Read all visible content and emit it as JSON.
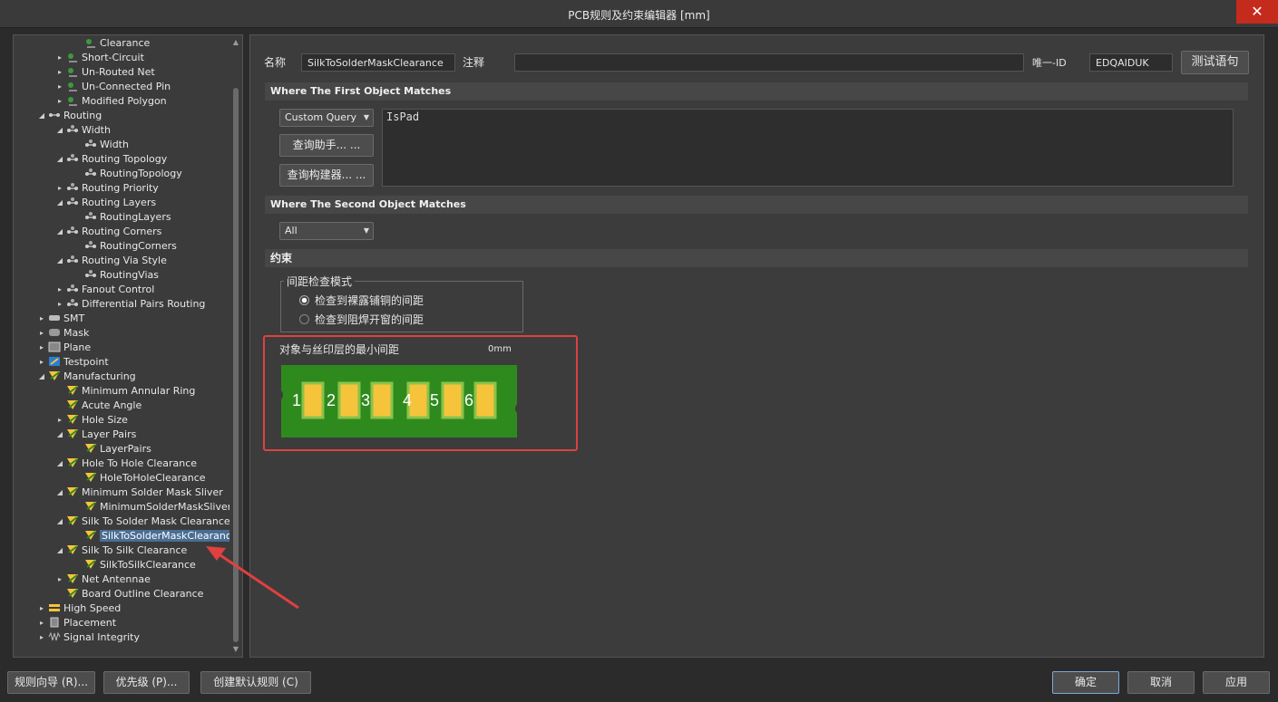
{
  "window": {
    "title": "PCB规则及约束编辑器 [mm]",
    "close_glyph": "✕"
  },
  "tree": {
    "items": [
      {
        "label": "Clearance",
        "level": 3,
        "toggle": "",
        "icon": "clearance-rule-icon"
      },
      {
        "label": "Short-Circuit",
        "level": 2,
        "toggle": "▸",
        "icon": "short-circuit-icon"
      },
      {
        "label": "Un-Routed Net",
        "level": 2,
        "toggle": "▸",
        "icon": "unrouted-net-icon"
      },
      {
        "label": "Un-Connected Pin",
        "level": 2,
        "toggle": "▸",
        "icon": "unconnected-pin-icon"
      },
      {
        "label": "Modified Polygon",
        "level": 2,
        "toggle": "▸",
        "icon": "modified-polygon-icon"
      },
      {
        "label": "Routing",
        "level": 1,
        "toggle": "◢",
        "icon": "routing-category-icon"
      },
      {
        "label": "Width",
        "level": 2,
        "toggle": "◢",
        "icon": "routing-rule-icon"
      },
      {
        "label": "Width",
        "level": 3,
        "toggle": "",
        "icon": "routing-rule-icon"
      },
      {
        "label": "Routing Topology",
        "level": 2,
        "toggle": "◢",
        "icon": "routing-rule-icon"
      },
      {
        "label": "RoutingTopology",
        "level": 3,
        "toggle": "",
        "icon": "routing-rule-icon"
      },
      {
        "label": "Routing Priority",
        "level": 2,
        "toggle": "▸",
        "icon": "routing-rule-icon"
      },
      {
        "label": "Routing Layers",
        "level": 2,
        "toggle": "◢",
        "icon": "routing-rule-icon"
      },
      {
        "label": "RoutingLayers",
        "level": 3,
        "toggle": "",
        "icon": "routing-rule-icon"
      },
      {
        "label": "Routing Corners",
        "level": 2,
        "toggle": "◢",
        "icon": "routing-rule-icon"
      },
      {
        "label": "RoutingCorners",
        "level": 3,
        "toggle": "",
        "icon": "routing-rule-icon"
      },
      {
        "label": "Routing Via Style",
        "level": 2,
        "toggle": "◢",
        "icon": "routing-rule-icon"
      },
      {
        "label": "RoutingVias",
        "level": 3,
        "toggle": "",
        "icon": "routing-rule-icon"
      },
      {
        "label": "Fanout Control",
        "level": 2,
        "toggle": "▸",
        "icon": "routing-rule-icon"
      },
      {
        "label": "Differential Pairs Routing",
        "level": 2,
        "toggle": "▸",
        "icon": "routing-rule-icon"
      },
      {
        "label": "SMT",
        "level": 1,
        "toggle": "▸",
        "icon": "smt-icon"
      },
      {
        "label": "Mask",
        "level": 1,
        "toggle": "▸",
        "icon": "mask-icon"
      },
      {
        "label": "Plane",
        "level": 1,
        "toggle": "▸",
        "icon": "plane-icon"
      },
      {
        "label": "Testpoint",
        "level": 1,
        "toggle": "▸",
        "icon": "testpoint-icon"
      },
      {
        "label": "Manufacturing",
        "level": 1,
        "toggle": "◢",
        "icon": "manufacturing-icon"
      },
      {
        "label": "Minimum Annular Ring",
        "level": 2,
        "toggle": "",
        "icon": "manufacturing-rule-icon"
      },
      {
        "label": "Acute Angle",
        "level": 2,
        "toggle": "",
        "icon": "manufacturing-rule-icon"
      },
      {
        "label": "Hole Size",
        "level": 2,
        "toggle": "▸",
        "icon": "manufacturing-rule-icon"
      },
      {
        "label": "Layer Pairs",
        "level": 2,
        "toggle": "◢",
        "icon": "manufacturing-rule-icon"
      },
      {
        "label": "LayerPairs",
        "level": 3,
        "toggle": "",
        "icon": "manufacturing-rule-icon"
      },
      {
        "label": "Hole To Hole Clearance",
        "level": 2,
        "toggle": "◢",
        "icon": "manufacturing-rule-icon"
      },
      {
        "label": "HoleToHoleClearance",
        "level": 3,
        "toggle": "",
        "icon": "manufacturing-rule-icon"
      },
      {
        "label": "Minimum Solder Mask Sliver",
        "level": 2,
        "toggle": "◢",
        "icon": "manufacturing-rule-icon"
      },
      {
        "label": "MinimumSolderMaskSliver",
        "level": 3,
        "toggle": "",
        "icon": "manufacturing-rule-icon"
      },
      {
        "label": "Silk To Solder Mask Clearance",
        "level": 2,
        "toggle": "◢",
        "icon": "manufacturing-rule-icon"
      },
      {
        "label": "SilkToSolderMaskClearance",
        "level": 3,
        "toggle": "",
        "icon": "manufacturing-rule-icon",
        "selected": true
      },
      {
        "label": "Silk To Silk Clearance",
        "level": 2,
        "toggle": "◢",
        "icon": "manufacturing-rule-icon"
      },
      {
        "label": "SilkToSilkClearance",
        "level": 3,
        "toggle": "",
        "icon": "manufacturing-rule-icon"
      },
      {
        "label": "Net Antennae",
        "level": 2,
        "toggle": "▸",
        "icon": "manufacturing-rule-icon"
      },
      {
        "label": "Board Outline Clearance",
        "level": 2,
        "toggle": "",
        "icon": "manufacturing-rule-icon"
      },
      {
        "label": "High Speed",
        "level": 1,
        "toggle": "▸",
        "icon": "high-speed-icon"
      },
      {
        "label": "Placement",
        "level": 1,
        "toggle": "▸",
        "icon": "placement-icon"
      },
      {
        "label": "Signal Integrity",
        "level": 1,
        "toggle": "▸",
        "icon": "signal-integrity-icon"
      }
    ]
  },
  "rule": {
    "name_label": "名称",
    "name_value": "SilkToSolderMaskClearance",
    "comment_label": "注释",
    "comment_value": "",
    "unique_id_label": "唯一-ID",
    "unique_id_value": "EDQAIDUK",
    "test_button": "测试语句"
  },
  "first_match": {
    "header": "Where The First Object Matches",
    "query_type": "Custom Query",
    "query_helper_button": "查询助手... ...",
    "query_builder_button": "查询构建器... ...",
    "query_text": "IsPad"
  },
  "second_match": {
    "header": "Where The Second Object Matches",
    "query_type": "All"
  },
  "constraints": {
    "header": "约束",
    "check_mode_label": "间距检查模式",
    "options": [
      {
        "label": "检查到裸露铺铜的间距",
        "checked": true
      },
      {
        "label": "检查到阻焊开窗的间距",
        "checked": false
      }
    ],
    "min_clearance_label": "对象与丝印层的最小间距",
    "min_clearance_value": "0mm",
    "pad_labels": [
      "1",
      "2",
      "3",
      "4",
      "5",
      "6"
    ],
    "colors": {
      "board": "#2f8a1e",
      "pad": "#f5c43a",
      "highlight": "#e04040"
    }
  },
  "bottom": {
    "rule_wizard": "规则向导 (R)...",
    "priorities": "优先级 (P)...",
    "create_default_rules": "创建默认规则 (C)",
    "ok": "确定",
    "cancel": "取消",
    "apply": "应用"
  },
  "annotation": {
    "arrow_color": "#e04040"
  }
}
